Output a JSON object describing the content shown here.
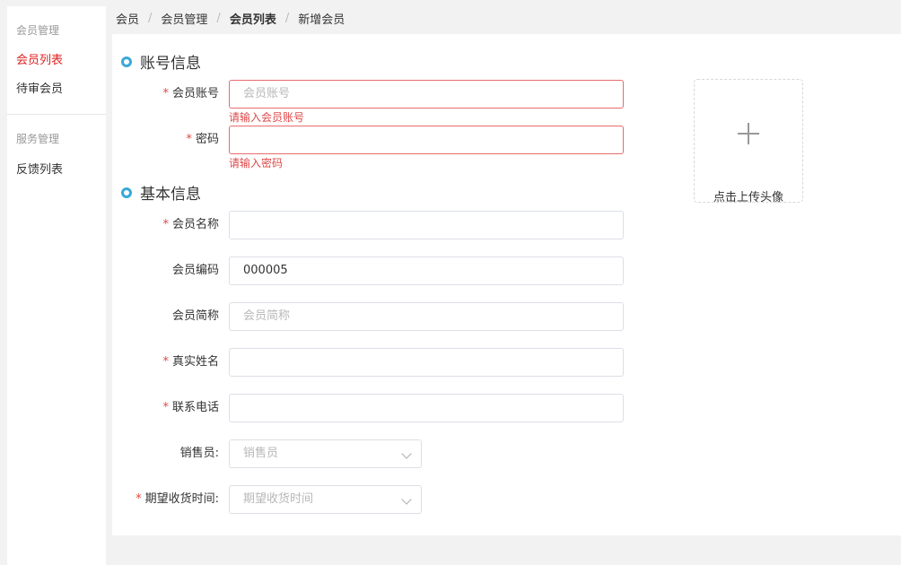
{
  "sidebar": {
    "groups": [
      {
        "title": "会员管理",
        "items": [
          "会员列表",
          "待审会员"
        ]
      },
      {
        "title": "服务管理",
        "items": [
          "反馈列表"
        ]
      }
    ],
    "active_item": "会员列表"
  },
  "breadcrumb": [
    "会员",
    "会员管理",
    "会员列表",
    "新增会员"
  ],
  "account_section": {
    "title": "账号信息",
    "fields": [
      {
        "label": "会员账号",
        "required": true,
        "value": "",
        "placeholder": "会员账号",
        "error": "请输入会员账号"
      },
      {
        "label": "密码",
        "required": true,
        "value": "",
        "placeholder": "",
        "error": "请输入密码"
      }
    ]
  },
  "basic_section": {
    "title": "基本信息",
    "fields": [
      {
        "label": "会员名称",
        "required": true,
        "value": "",
        "placeholder": ""
      },
      {
        "label": "会员编码",
        "required": false,
        "value": "000005",
        "placeholder": ""
      },
      {
        "label": "会员简称",
        "required": false,
        "value": "",
        "placeholder": "会员简称"
      },
      {
        "label": "真实姓名",
        "required": true,
        "value": "",
        "placeholder": ""
      },
      {
        "label": "联系电话",
        "required": true,
        "value": "",
        "placeholder": ""
      },
      {
        "label": "销售员:",
        "required": false,
        "value": "",
        "placeholder": "销售员",
        "type": "select"
      },
      {
        "label": "期望收货时间:",
        "required": true,
        "value": "",
        "placeholder": "期望收货时间",
        "type": "select"
      }
    ]
  },
  "upload": {
    "label": "点击上传头像",
    "icon": "plus-icon"
  },
  "colors": {
    "accent": "#3aa8d8",
    "error": "#e04848",
    "active": "#e02020"
  }
}
